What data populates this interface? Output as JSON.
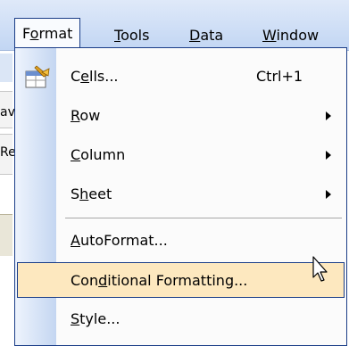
{
  "menubar": {
    "items": [
      {
        "pre": "F",
        "ul": "o",
        "post": "rmat"
      },
      {
        "pre": "",
        "ul": "T",
        "post": "ools"
      },
      {
        "pre": "",
        "ul": "D",
        "post": "ata"
      },
      {
        "pre": "",
        "ul": "W",
        "post": "indow"
      }
    ]
  },
  "background": {
    "fragment1": "av",
    "fragment2": "Re"
  },
  "dropdown": {
    "cells": {
      "pre": "C",
      "ul": "e",
      "post": "lls...",
      "shortcut": "Ctrl+1",
      "icon": "format-cells-icon"
    },
    "row": {
      "pre": "",
      "ul": "R",
      "post": "ow"
    },
    "column": {
      "pre": "",
      "ul": "C",
      "post": "olumn"
    },
    "sheet": {
      "pre": "S",
      "ul": "h",
      "post": "eet"
    },
    "autoformat": {
      "pre": "",
      "ul": "A",
      "post": "utoFormat..."
    },
    "conditional": {
      "pre": "Con",
      "ul": "d",
      "post": "itional Formatting..."
    },
    "style": {
      "pre": "",
      "ul": "S",
      "post": "tyle..."
    }
  },
  "colors": {
    "highlight": "#fde8bf",
    "border": "#1a3d87",
    "gutter": "#c4d6f1"
  }
}
